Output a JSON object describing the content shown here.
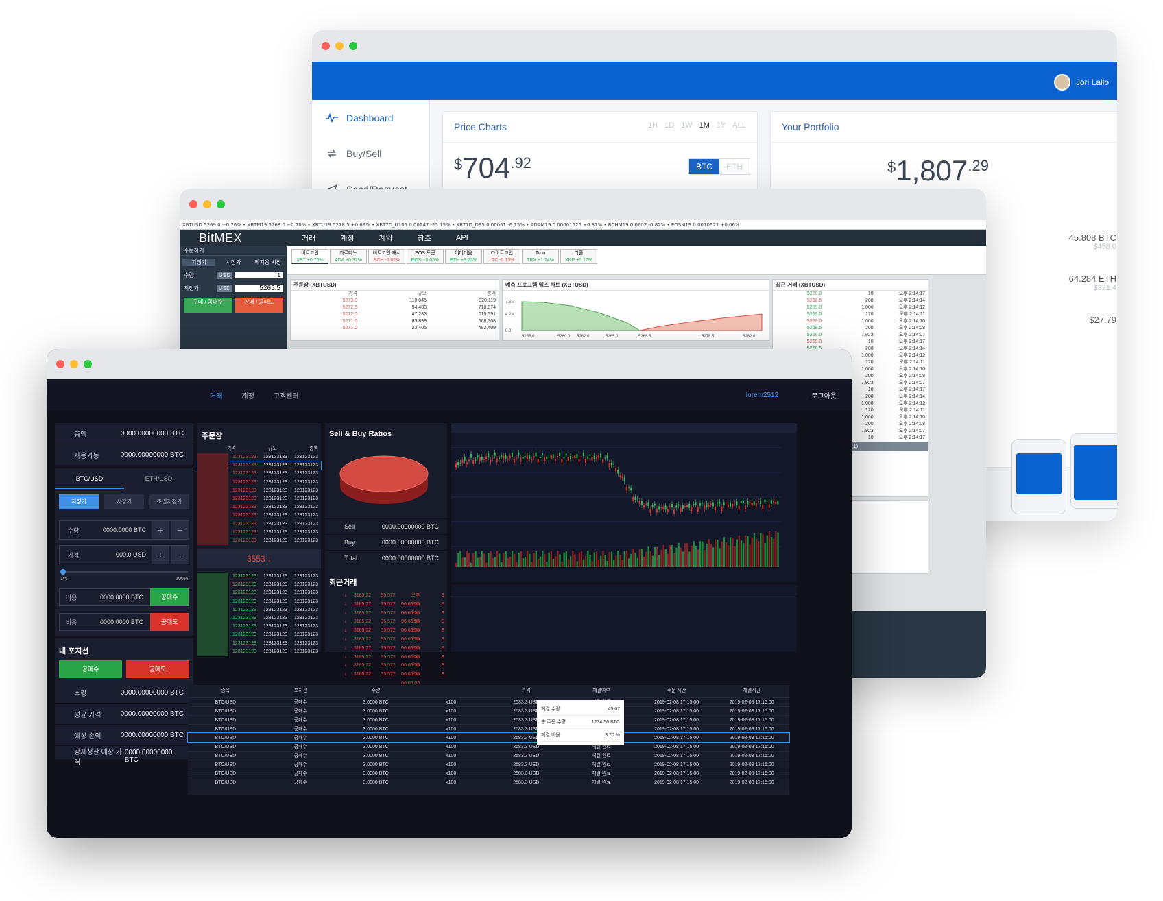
{
  "portfolio_app": {
    "user_name": "Jori Lallo",
    "nav": [
      {
        "label": "Dashboard",
        "icon": "pulse-icon",
        "active": true
      },
      {
        "label": "Buy/Sell",
        "icon": "exchange-icon",
        "active": false
      },
      {
        "label": "Send/Request",
        "icon": "send-icon",
        "active": false
      }
    ],
    "price_charts": {
      "title": "Price Charts",
      "timeframes": [
        "1H",
        "1D",
        "1W",
        "1M",
        "1Y",
        "ALL"
      ],
      "active_timeframe": "1M",
      "price_symbol": "$",
      "price_int": "704",
      "price_dec": ".92",
      "coins": [
        "BTC",
        "ETH"
      ],
      "active_coin": "BTC"
    },
    "portfolio": {
      "title": "Your Portfolio",
      "balance_symbol": "$",
      "balance_int": "1,807",
      "balance_dec": ".29",
      "holdings": [
        {
          "amount": "45.808 BTC",
          "value": "$458.0"
        },
        {
          "amount": "64.284 ETH",
          "value": "$321.4"
        },
        {
          "amount": "$27.79",
          "value": ""
        }
      ]
    }
  },
  "bitmex_app": {
    "ticker": "XBTUSD 5269.0 +0.76% • XBTM19 5268.0 +0.70% • XBTU19 5278.5 +0.69% • XBT7D_U105 0.00247 -25.15% • XBT7D_D95 0.00061 -6.15% • ADAM19 0.00001626 +0.37% • BCHM19 0.0602 -0.82% • EOSM19 0.0010621 +0.06%",
    "logo": "BitMEX",
    "nav": [
      "거래",
      "계정",
      "계약",
      "참조",
      "API"
    ],
    "order_panel_title": "주문하기",
    "order_types": [
      "지정가",
      "시장가",
      "메지용 시장"
    ],
    "qty_label": "수량",
    "qty_currency": "USD",
    "qty_value": "1",
    "price_label": "지정가",
    "price_value": "5265.5",
    "buy_button": "구매 / 공매수",
    "sell_button": "판매 / 공매도",
    "coin_tabs": [
      {
        "name": "비트코인",
        "sub": "XBT +0.76%"
      },
      {
        "name": "카르다노",
        "sub": "ADA +0.37%"
      },
      {
        "name": "비트코인 캐시",
        "sub": "BCH -0.82%"
      },
      {
        "name": "EOS 토큰",
        "sub": "EOS +0.05%"
      },
      {
        "name": "이더리움",
        "sub": "ETH +3.23%"
      },
      {
        "name": "라이트코인",
        "sub": "LTC -0.13%"
      },
      {
        "name": "Tron",
        "sub": "TRX +1.74%"
      },
      {
        "name": "리플",
        "sub": "XRP +5.17%"
      }
    ],
    "orderbook_title": "주문장 (XBTUSD)",
    "orderbook_headers": [
      "가격",
      "규모",
      "총액"
    ],
    "orderbook_rows": [
      [
        "5273.0",
        "110,045",
        "820,119"
      ],
      [
        "5272.5",
        "94,483",
        "710,074"
      ],
      [
        "5272.0",
        "47,283",
        "615,591"
      ],
      [
        "5271.5",
        "85,899",
        "568,308"
      ],
      [
        "5271.0",
        "23,405",
        "482,409"
      ]
    ],
    "depth_title": "예측 프로그램 뎁스 차트 (XBTUSD)",
    "depth_xticks": [
      "5255.0",
      "5260.0",
      "5262.0",
      "5265.0",
      "5268.5",
      "5276.5",
      "5282.0"
    ],
    "depth_yticks": [
      "7.5M",
      "4.2M",
      "0.0"
    ],
    "trades_title": "최근 거래 (XBTUSD)",
    "trades": [
      [
        "5269.0",
        "10",
        "오후 2:14:17"
      ],
      [
        "5268.5",
        "200",
        "오후 2:14:14"
      ],
      [
        "5269.0",
        "1,000",
        "오후 2:14:12"
      ],
      [
        "5269.0",
        "170",
        "오후 2:14:11"
      ],
      [
        "5269.0",
        "1,000",
        "오후 2:14:10"
      ],
      [
        "5268.5",
        "200",
        "오후 2:14:08"
      ],
      [
        "5269.0",
        "7,923",
        "오후 2:14:07"
      ]
    ],
    "trollbox": "Trollbox (1)"
  },
  "dark_exchange": {
    "nav": [
      "거래",
      "계정",
      "고객센터"
    ],
    "active_nav": "거래",
    "username": "lorem2512",
    "logout": "로그아웃",
    "balances": [
      {
        "label": "총액",
        "value": "0000.00000000 BTC"
      },
      {
        "label": "사용가능",
        "value": "0000.00000000 BTC"
      }
    ],
    "pair_tabs": [
      "BTC/USD",
      "ETH/USD"
    ],
    "order_types": [
      "지정가",
      "시장가",
      "조건지정가"
    ],
    "qty": {
      "label": "수량",
      "value": "0000.0000 BTC"
    },
    "price": {
      "label": "가격",
      "value": "000.0 USD"
    },
    "slider_min": "1%",
    "slider_max": "100%",
    "buy_row": {
      "label": "비용",
      "value": "0000.0000 BTC",
      "button": "공매수"
    },
    "sell_row": {
      "label": "비용",
      "value": "0000.0000 BTC",
      "button": "공매도"
    },
    "position": {
      "title": "내 포지션",
      "buy": "공매수",
      "sell": "공매도",
      "rows": [
        {
          "label": "수량",
          "value": "0000.00000000 BTC"
        },
        {
          "label": "평균 가격",
          "value": "0000.00000000 BTC"
        },
        {
          "label": "예상 손익",
          "value": "0000.00000000 BTC"
        },
        {
          "label": "강제청산 예상 가격",
          "value": "0000.00000000 BTC"
        }
      ]
    },
    "orderbook": {
      "title": "주문장",
      "headers": [
        "가격",
        "규모",
        "총액"
      ],
      "cell": "123123123",
      "last_price": "3553 ↓"
    },
    "ratios": {
      "title": "Sell & Buy Ratios",
      "rows": [
        {
          "label": "Sell",
          "value": "0000.00000000 BTC"
        },
        {
          "label": "Buy",
          "value": "0000.00000000 BTC"
        },
        {
          "label": "Total",
          "value": "0000.00000000 BTC"
        }
      ]
    },
    "recent": {
      "title": "최근거래",
      "row": [
        "↓",
        "3185.22",
        "35.572",
        "오후 06:65:55",
        "S"
      ]
    },
    "table": {
      "headers": [
        "종목",
        "포지션",
        "수량",
        "",
        "가격",
        "체결여부",
        "주문 시간",
        "체결시간"
      ],
      "row": [
        "BTC/USD",
        "공매수",
        "3.0000 BTC",
        "x100",
        "2583.3 USD",
        "체결 완료",
        "2019-02-08 17:15:00",
        "2019-02-08 17:15:00"
      ]
    },
    "tooltip": [
      {
        "label": "체결 수량",
        "value": "45.67"
      },
      {
        "label": "총 주문 수량",
        "value": "1234.56 BTC"
      },
      {
        "label": "체결 비율",
        "value": "3.70 %"
      }
    ]
  },
  "colors": {
    "blue": "#0a62d0",
    "sell": "#e0433b",
    "buy": "#35c05a",
    "dark_bg": "#12121e",
    "bitmex_nav": "#23303c"
  }
}
